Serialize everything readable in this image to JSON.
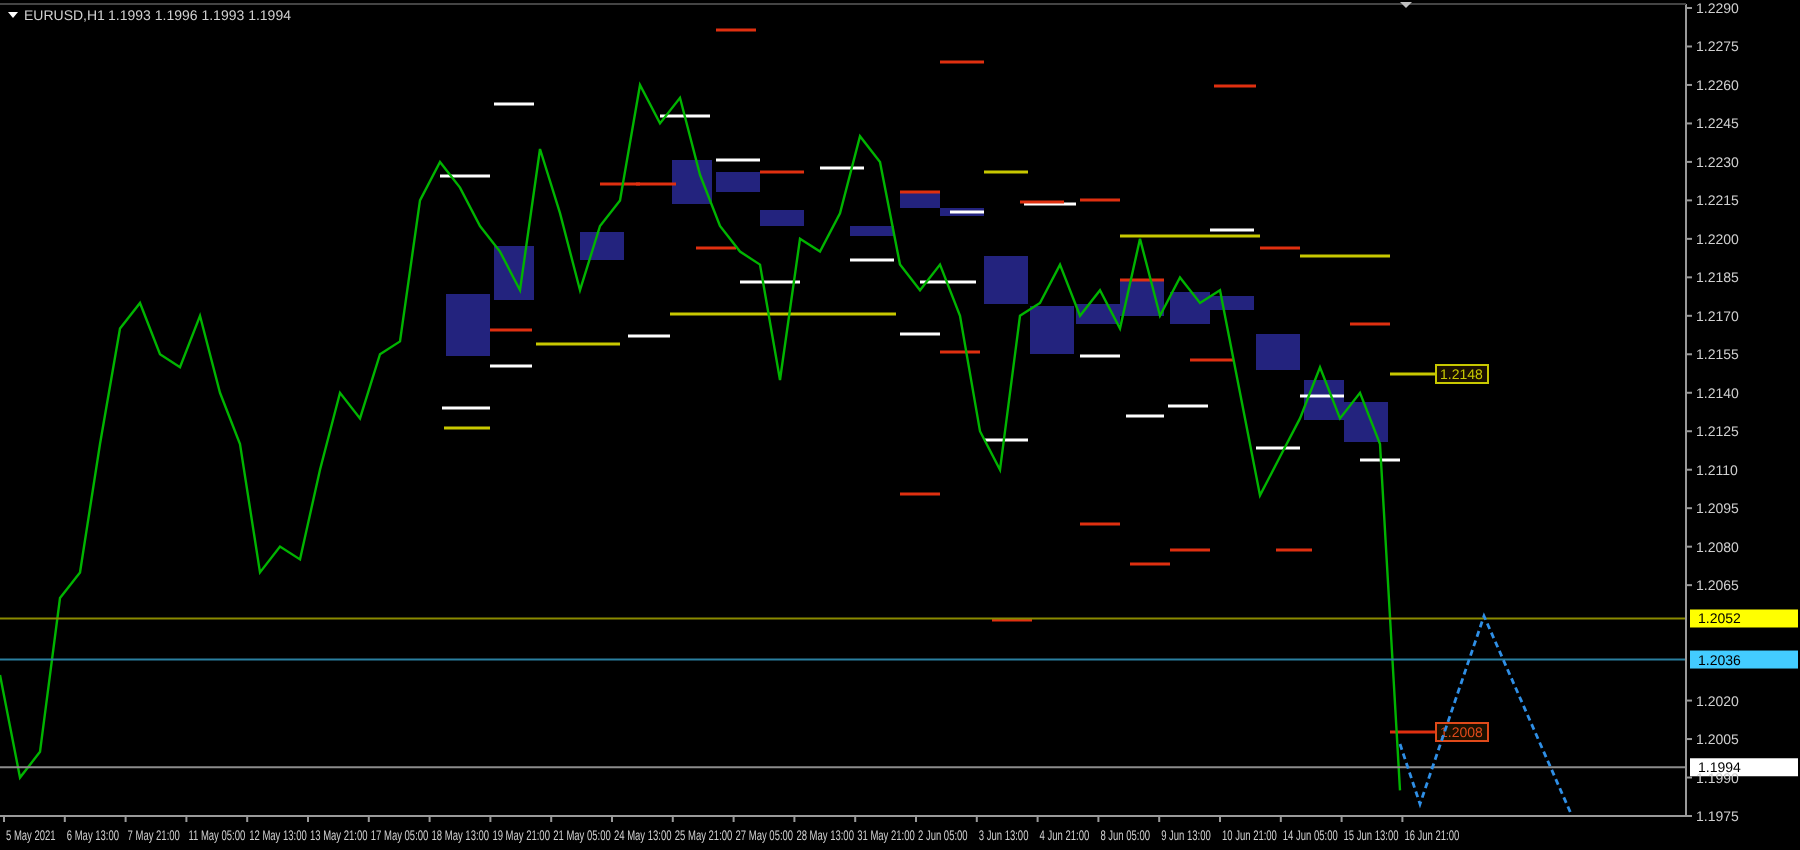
{
  "header": {
    "quote": "1.1993 1.1996 1.1993 1.1994"
  },
  "chart_data": {
    "type": "line",
    "ylim": [
      1.1975,
      1.229
    ],
    "series": [
      {
        "name": "EURUSD,H1",
        "color": "#00b400",
        "values": [
          1.203,
          1.199,
          1.2,
          1.206,
          1.207,
          1.212,
          1.2165,
          1.2175,
          1.2155,
          1.215,
          1.217,
          1.214,
          1.212,
          1.207,
          1.208,
          1.2075,
          1.211,
          1.214,
          1.213,
          1.2155,
          1.216,
          1.2215,
          1.223,
          1.222,
          1.2205,
          1.2195,
          1.218,
          1.2235,
          1.221,
          1.218,
          1.2205,
          1.2215,
          1.226,
          1.2245,
          1.2255,
          1.2225,
          1.2205,
          1.2195,
          1.219,
          1.2145,
          1.22,
          1.2195,
          1.221,
          1.224,
          1.223,
          1.219,
          1.218,
          1.219,
          1.217,
          1.2125,
          1.211,
          1.217,
          1.2175,
          1.219,
          1.217,
          1.218,
          1.2165,
          1.22,
          1.217,
          1.2185,
          1.2175,
          1.218,
          1.214,
          1.21,
          1.2115,
          1.213,
          1.215,
          1.213,
          1.214,
          1.212,
          1.1985
        ]
      }
    ],
    "yticks": [
      {
        "value": 1.229,
        "label": "1.2290"
      },
      {
        "value": 1.2275,
        "label": "1.2275"
      },
      {
        "value": 1.226,
        "label": "1.2260"
      },
      {
        "value": 1.2245,
        "label": "1.2245"
      },
      {
        "value": 1.223,
        "label": "1.2230"
      },
      {
        "value": 1.2215,
        "label": "1.2215"
      },
      {
        "value": 1.22,
        "label": "1.2200"
      },
      {
        "value": 1.2185,
        "label": "1.2185"
      },
      {
        "value": 1.217,
        "label": "1.2170"
      },
      {
        "value": 1.2155,
        "label": "1.2155"
      },
      {
        "value": 1.214,
        "label": "1.2140"
      },
      {
        "value": 1.2125,
        "label": "1.2125"
      },
      {
        "value": 1.211,
        "label": "1.2110"
      },
      {
        "value": 1.2095,
        "label": "1.2095"
      },
      {
        "value": 1.208,
        "label": "1.2080"
      },
      {
        "value": 1.2065,
        "label": "1.2065"
      },
      {
        "value": 1.202,
        "label": "1.2020"
      },
      {
        "value": 1.2005,
        "label": "1.2005"
      },
      {
        "value": 1.199,
        "label": "1.1990"
      },
      {
        "value": 1.1975,
        "label": "1.1975"
      }
    ],
    "ref_lines": [
      {
        "axis": "y",
        "value": 1.2052,
        "label": "1.2052",
        "color": "#8a8a00"
      },
      {
        "axis": "y",
        "value": 1.2036,
        "label": "1.2036",
        "color": "#2a7f9f"
      },
      {
        "axis": "y",
        "value": 1.1994,
        "label": "1.1994",
        "color": "#8c8c8c"
      }
    ]
  },
  "price_labels": [
    {
      "text": "1.2148",
      "color": "#c8c800"
    },
    {
      "text": "1.2008",
      "color": "#e04a1a"
    }
  ],
  "time_axis": {
    "labels": [
      "5 May 2021",
      "6 May 13:00",
      "7 May 21:00",
      "11 May 05:00",
      "12 May 13:00",
      "13 May 21:00",
      "17 May 05:00",
      "18 May 13:00",
      "19 May 21:00",
      "21 May 05:00",
      "24 May 13:00",
      "25 May 21:00",
      "27 May 05:00",
      "28 May 13:00",
      "31 May 21:00",
      "2 Jun 05:00",
      "3 Jun 13:00",
      "4 Jun 21:00",
      "8 Jun 05:00",
      "9 Jun 13:00",
      "10 Jun 21:00",
      "14 Jun 05:00",
      "15 Jun 13:00",
      "16 Jun 21:00"
    ]
  }
}
